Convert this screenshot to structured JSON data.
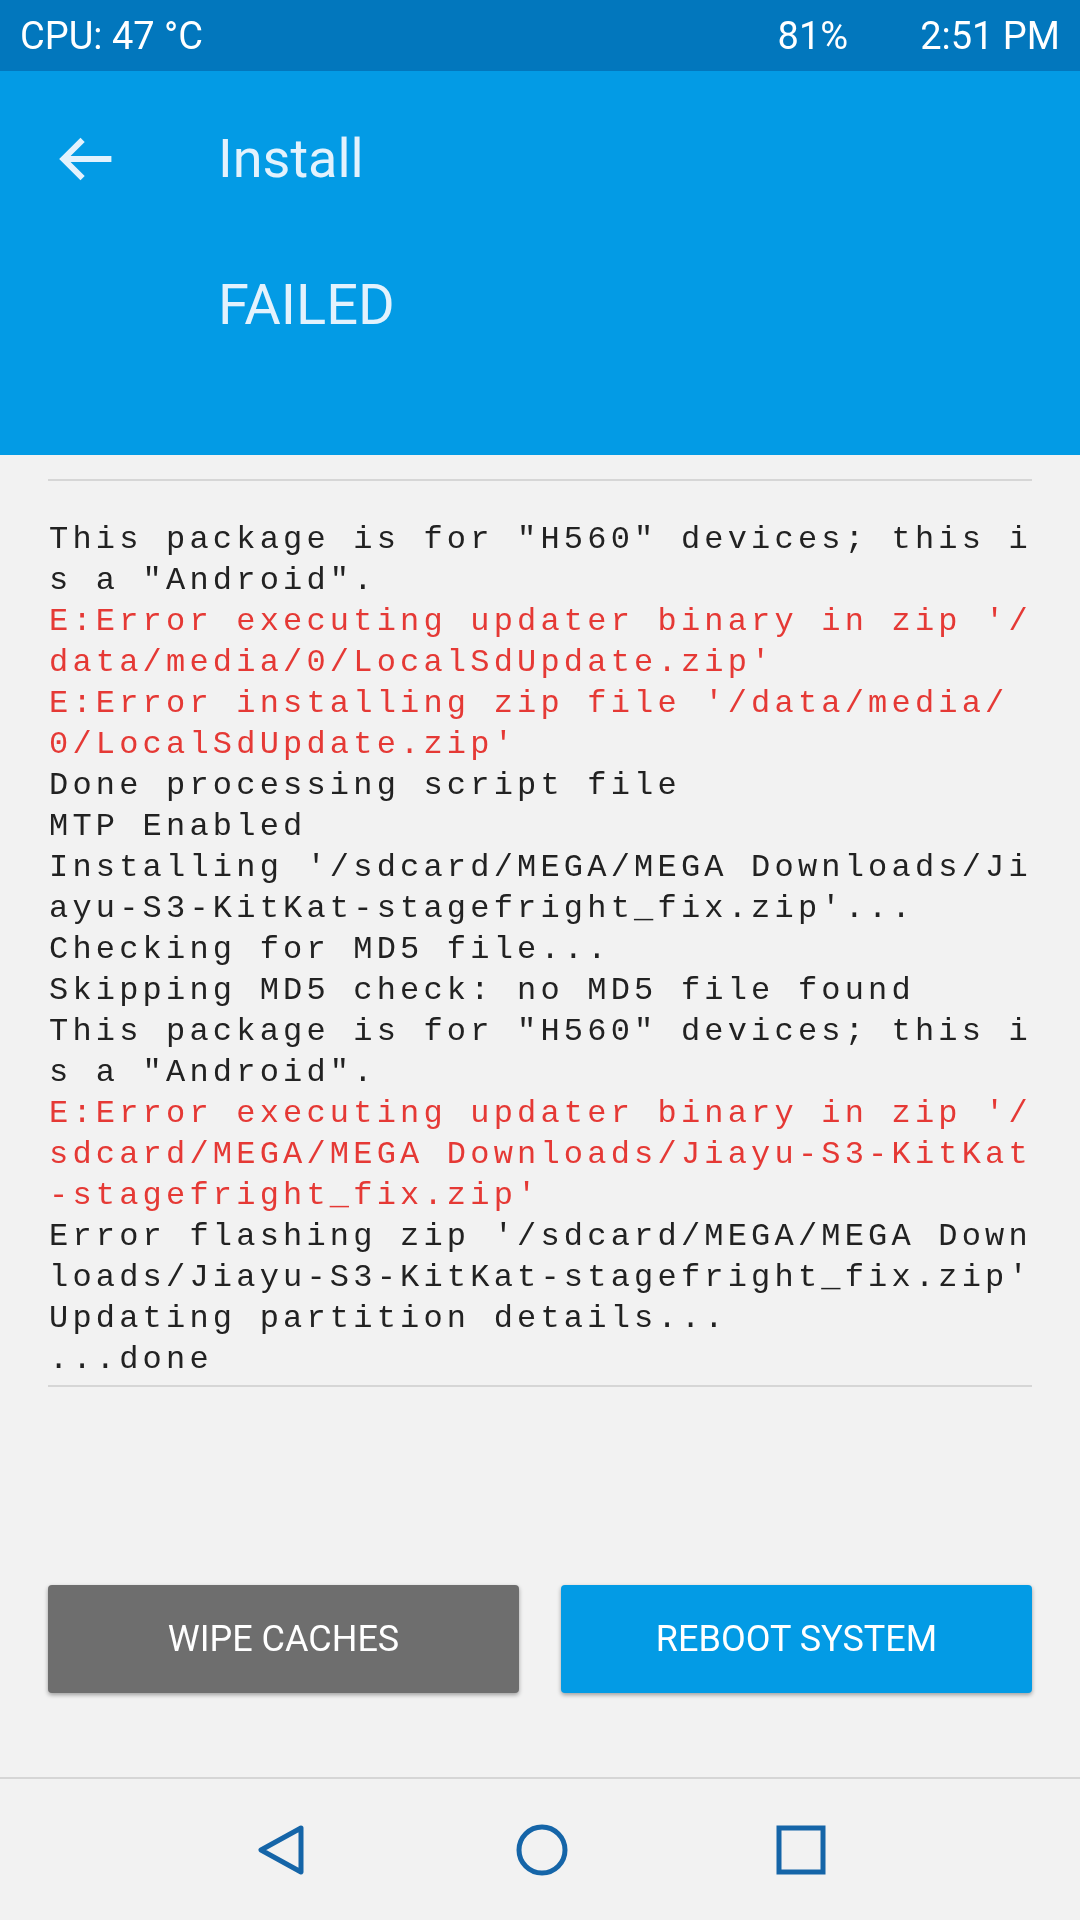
{
  "status_bar": {
    "cpu": "CPU: 47 °C",
    "battery": "81%",
    "time": "2:51 PM"
  },
  "header": {
    "title": "Install",
    "result": "FAILED"
  },
  "log": [
    {
      "kind": "normal",
      "text": "This package is for \"H560\" devices; this is a \"Android\"."
    },
    {
      "kind": "error",
      "text": "E:Error executing updater binary in zip '/data/media/0/LocalSdUpdate.zip'"
    },
    {
      "kind": "error",
      "text": "E:Error installing zip file '/data/media/0/LocalSdUpdate.zip'"
    },
    {
      "kind": "normal",
      "text": "Done processing script file"
    },
    {
      "kind": "normal",
      "text": "MTP Enabled"
    },
    {
      "kind": "normal",
      "text": "Installing '/sdcard/MEGA/MEGA Downloads/Jiayu-S3-KitKat-stagefright_fix.zip'..."
    },
    {
      "kind": "normal",
      "text": "Checking for MD5 file..."
    },
    {
      "kind": "normal",
      "text": "Skipping MD5 check: no MD5 file found"
    },
    {
      "kind": "normal",
      "text": "This package is for \"H560\" devices; this is a \"Android\"."
    },
    {
      "kind": "error",
      "text": "E:Error executing updater binary in zip '/sdcard/MEGA/MEGA Downloads/Jiayu-S3-KitKat-stagefright_fix.zip'"
    },
    {
      "kind": "normal",
      "text": "Error flashing zip '/sdcard/MEGA/MEGA Downloads/Jiayu-S3-KitKat-stagefright_fix.zip'"
    },
    {
      "kind": "normal",
      "text": "Updating partition details..."
    },
    {
      "kind": "normal",
      "text": "...done"
    }
  ],
  "buttons": [
    {
      "kind": "secondary",
      "label": "WIPE CACHES"
    },
    {
      "kind": "primary",
      "label": "REBOOT SYSTEM"
    }
  ]
}
